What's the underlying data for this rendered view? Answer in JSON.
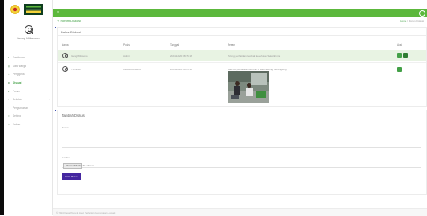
{
  "app": {
    "user_name": "Iseng Wibisono",
    "colors": {
      "topbar": "#5cb83c",
      "accent": "#43a047",
      "send_button": "#4527a0",
      "row_highlight": "#e8f3e3"
    },
    "menu_icon": "hamburger-icon"
  },
  "sidebar": {
    "items": [
      {
        "label": "Dashboard",
        "icon": "dashboard-icon"
      },
      {
        "label": "Data Warga",
        "icon": "users-icon"
      },
      {
        "label": "Pengguna",
        "icon": "user-icon"
      },
      {
        "label": "Diskusi",
        "icon": "chat-icon",
        "active": true
      },
      {
        "label": "Forum",
        "icon": "forum-icon"
      },
      {
        "label": "Sekolah",
        "icon": "school-icon",
        "has_children": true
      },
      {
        "label": "Pengumuman",
        "icon": "bell-icon"
      },
      {
        "label": "Setting",
        "icon": "gear-icon"
      },
      {
        "label": "Keluar",
        "icon": "logout-icon"
      }
    ]
  },
  "page": {
    "title": "Forum Diskusi",
    "breadcrumb": [
      "Home",
      "Forum Diskusi"
    ]
  },
  "list_card": {
    "title": "Daftar Diskusi",
    "columns": [
      "Nama",
      "Posisi",
      "Tanggal",
      "Pesan",
      "Aksi"
    ],
    "rows": [
      {
        "nama": "Iseng Wibisono",
        "posisi": "Admin",
        "tanggal": "2024-12-20 08:35:18",
        "pesan": "Tolong perhatikan kembali kesehatan Sekolahnya"
      },
      {
        "nama": "Tumiman",
        "posisi": "Ketua Komisaris",
        "tanggal": "2024-12-20 08:25:15",
        "pesan": "Baik bu, perhatikan kembali di saat sedang berlangsung",
        "has_photo": true
      }
    ]
  },
  "form": {
    "title": "Tambah Diskusi",
    "message_label": "Pesan",
    "photo_label": "Gambar",
    "file_button": "Choose Files",
    "file_status": "No file chosen",
    "submit": "Kirim Pesan"
  },
  "footer": {
    "text": "© 2024 Desa Penu & Aset Pertanian Kecamatan Lumaju"
  }
}
